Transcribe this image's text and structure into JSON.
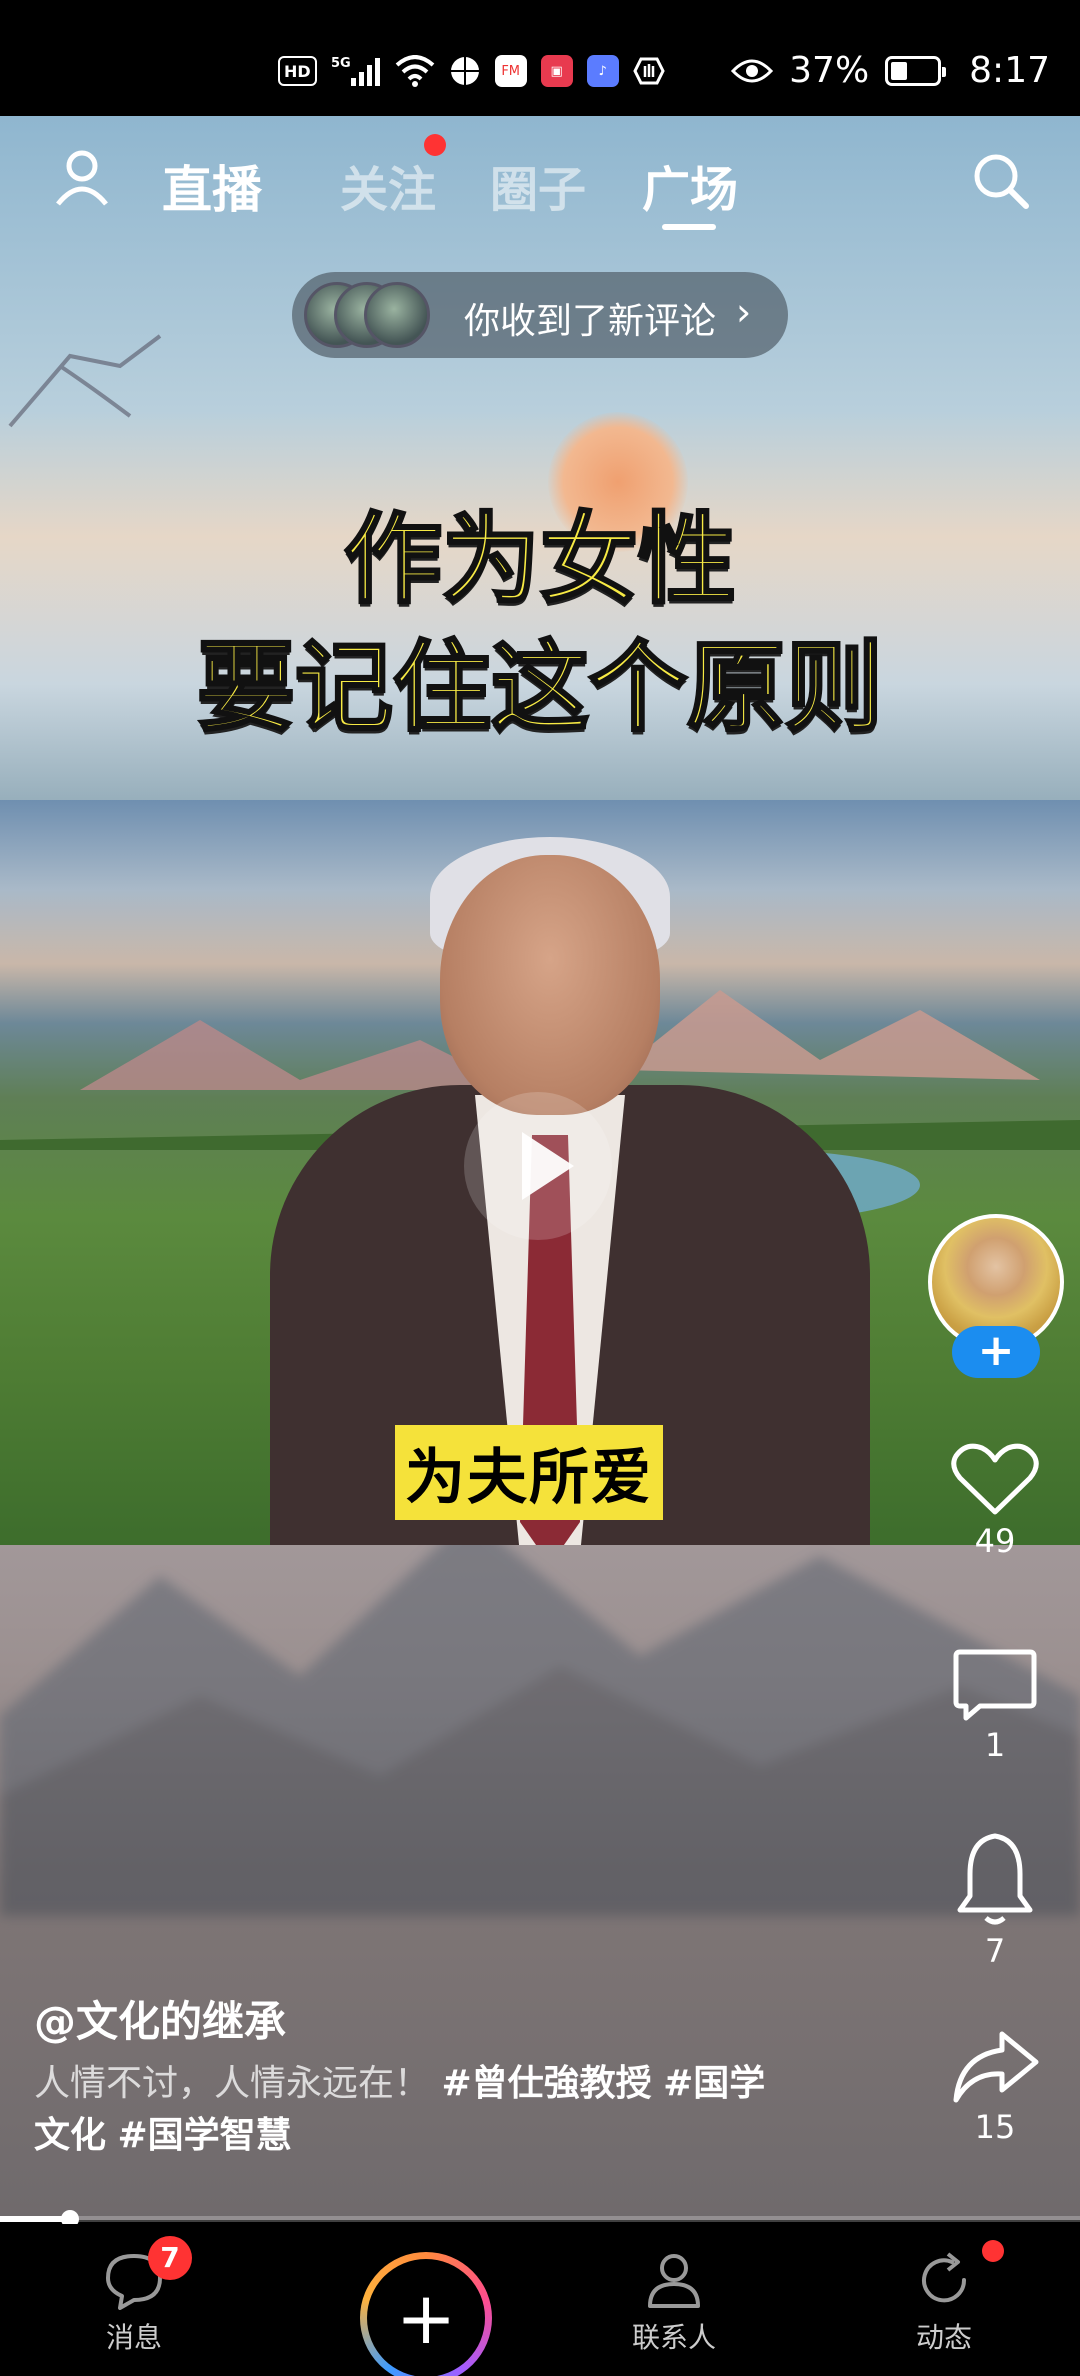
{
  "status_bar": {
    "hd": "HD",
    "network": "5G",
    "battery_percent": "37%",
    "time": "8:17"
  },
  "top_nav": {
    "live_label": "直播",
    "tabs": [
      {
        "label": "关注",
        "active": false,
        "has_dot": true
      },
      {
        "label": "圈子",
        "active": false
      },
      {
        "label": "广场",
        "active": true
      }
    ]
  },
  "notification": {
    "text": "你收到了新评论"
  },
  "video": {
    "title_line1": "作为女性",
    "title_line2": "要记住这个原则",
    "subtitle": "为夫所爱",
    "progress": 0.065
  },
  "actions": {
    "likes": "49",
    "comments": "1",
    "favorites": "7",
    "shares": "15",
    "follow_label": "+"
  },
  "caption": {
    "author": "@文化的继承",
    "text": "人情不讨，人情永远在！",
    "tags": [
      "#曾仕強教授",
      "#国学",
      "文化",
      "#国学智慧"
    ]
  },
  "bottom_nav": {
    "messages_label": "消息",
    "messages_badge": "7",
    "create_label": "+",
    "contacts_label": "联系人",
    "activity_label": "动态"
  },
  "colors": {
    "accent_blue": "#1b8df0",
    "badge_red": "#ff3333",
    "title_yellow": "#f7ea44"
  }
}
